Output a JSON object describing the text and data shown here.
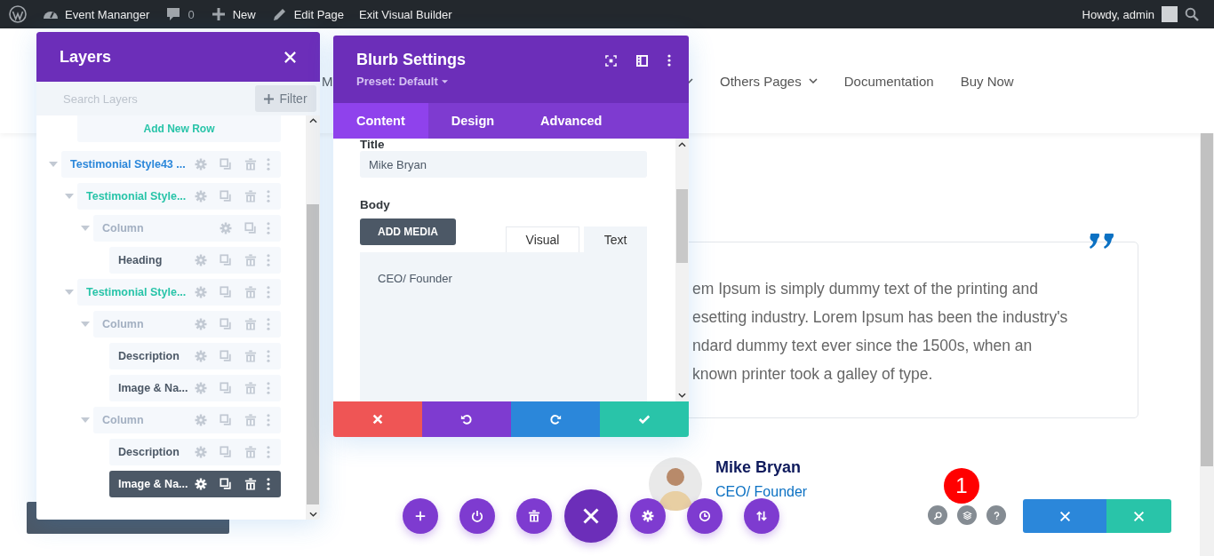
{
  "admin_bar": {
    "items": [
      {
        "kind": "logo"
      },
      {
        "kind": "dashboard",
        "label": "Event Mananger"
      },
      {
        "kind": "comments",
        "label": "0"
      },
      {
        "kind": "new",
        "label": "New"
      },
      {
        "kind": "edit",
        "label": "Edit Page"
      },
      {
        "kind": "plain",
        "label": "Exit Visual Builder"
      }
    ],
    "greeting": "Howdy, admin"
  },
  "nav": {
    "items": [
      {
        "label": "M",
        "dropdown": true
      },
      {
        "label": "Others Pages",
        "dropdown": true
      },
      {
        "label": "Documentation",
        "dropdown": false
      },
      {
        "label": "Buy Now",
        "dropdown": false
      }
    ]
  },
  "testimonial": {
    "body_lines": [
      "em Ipsum is simply dummy text of the printing and",
      "esetting industry. Lorem Ipsum has been the industry's",
      "ndard dummy text ever since the 1500s, when an",
      "known printer took a galley of type."
    ],
    "name": "Mike Bryan",
    "role": "CEO/ Founder"
  },
  "layers": {
    "title": "Layers",
    "search": {
      "placeholder": "Search Layers"
    },
    "filter_label": "Filter",
    "add_row": "Add New Row",
    "tree": [
      {
        "label": "Testimonial Style43 ...",
        "kind": "section",
        "expanded": true,
        "deletable": true,
        "selected": false,
        "children": [
          {
            "label": "Testimonial Style...",
            "kind": "row",
            "expanded": true,
            "deletable": true,
            "selected": false,
            "children": [
              {
                "label": "Column",
                "kind": "column",
                "expanded": true,
                "deletable": false,
                "selected": false,
                "children": [
                  {
                    "label": "Heading",
                    "kind": "module",
                    "deletable": true,
                    "selected": false
                  }
                ]
              }
            ]
          },
          {
            "label": "Testimonial Style...",
            "kind": "row",
            "expanded": true,
            "deletable": true,
            "selected": false,
            "children": [
              {
                "label": "Column",
                "kind": "column",
                "expanded": true,
                "deletable": true,
                "selected": false,
                "children": [
                  {
                    "label": "Description",
                    "kind": "module",
                    "deletable": true,
                    "selected": false
                  },
                  {
                    "label": "Image & Na...",
                    "kind": "module",
                    "deletable": true,
                    "selected": false
                  }
                ]
              },
              {
                "label": "Column",
                "kind": "column",
                "expanded": true,
                "deletable": true,
                "selected": false,
                "children": [
                  {
                    "label": "Description",
                    "kind": "module",
                    "deletable": true,
                    "selected": false
                  },
                  {
                    "label": "Image & Na...",
                    "kind": "module",
                    "deletable": true,
                    "selected": true
                  }
                ]
              }
            ]
          }
        ]
      }
    ]
  },
  "settings": {
    "title": "Blurb Settings",
    "preset": "Preset: Default",
    "tabs": [
      {
        "label": "Content",
        "selected": true
      },
      {
        "label": "Design",
        "selected": false
      },
      {
        "label": "Advanced",
        "selected": false
      }
    ],
    "title_field": {
      "label": "Title",
      "value": "Mike Bryan"
    },
    "body": {
      "label": "Body",
      "add_media": "ADD MEDIA",
      "editor_tabs": [
        {
          "label": "Visual",
          "selected": false
        },
        {
          "label": "Text",
          "selected": true
        }
      ],
      "content": "CEO/ Founder"
    }
  },
  "notification_badge": "1"
}
